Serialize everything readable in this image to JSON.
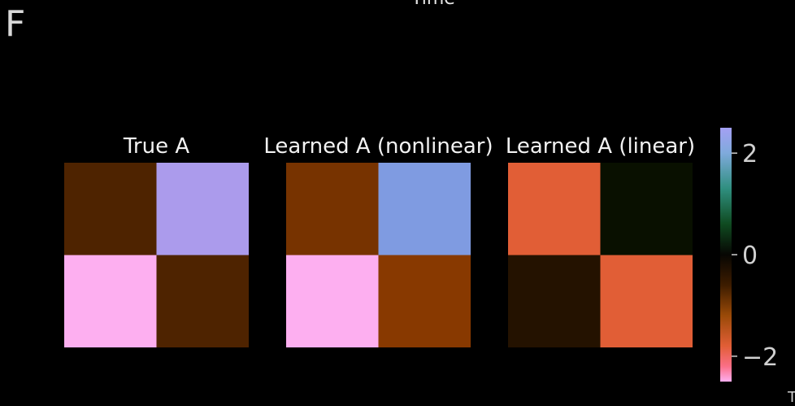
{
  "panel_label": "F",
  "top_title_fragment": "Time",
  "corner_mark": "T",
  "chart_data": {
    "type": "heatmap",
    "panels": [
      {
        "title": "True A",
        "values": [
          [
            -0.5,
            1.9
          ],
          [
            -2.4,
            -0.5
          ]
        ],
        "colors": [
          [
            "#4e2300",
            "#ab9bec"
          ],
          [
            "#fdaff0",
            "#4e2300"
          ]
        ]
      },
      {
        "title": "Learned A (nonlinear)",
        "values": [
          [
            -0.75,
            1.7
          ],
          [
            -2.4,
            -0.85
          ]
        ],
        "colors": [
          [
            "#773300",
            "#7f9be1"
          ],
          [
            "#fdaff0",
            "#883900"
          ]
        ]
      },
      {
        "title": "Learned A (linear)",
        "values": [
          [
            -1.6,
            0.1
          ],
          [
            -0.25,
            -1.6
          ]
        ],
        "colors": [
          [
            "#e15e36",
            "#091000"
          ],
          [
            "#241200",
            "#e15e36"
          ]
        ]
      }
    ],
    "colorbar": {
      "range": [
        -2.5,
        2.5
      ],
      "ticks": [
        2,
        0,
        -2
      ],
      "tick_labels": [
        "2",
        "0",
        "−2"
      ],
      "gradient": [
        {
          "v": 2.5,
          "color": "#a4a0f4"
        },
        {
          "v": 2.0,
          "color": "#7faadc"
        },
        {
          "v": 1.3,
          "color": "#2f8f7f"
        },
        {
          "v": 0.6,
          "color": "#0f4a20"
        },
        {
          "v": 0.0,
          "color": "#070603"
        },
        {
          "v": -0.6,
          "color": "#3d1c00"
        },
        {
          "v": -1.2,
          "color": "#9a4a08"
        },
        {
          "v": -1.8,
          "color": "#e15e36"
        },
        {
          "v": -2.2,
          "color": "#fb6f87"
        },
        {
          "v": -2.5,
          "color": "#fdaff0"
        }
      ]
    }
  }
}
